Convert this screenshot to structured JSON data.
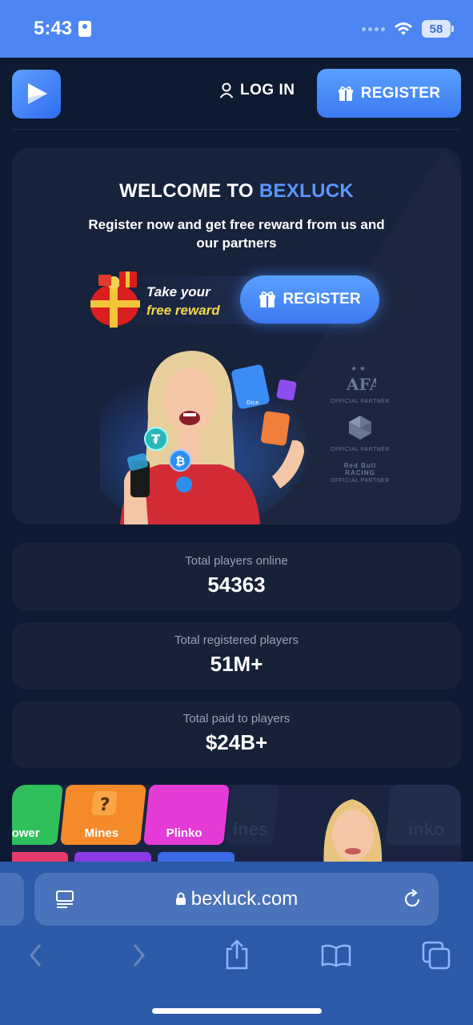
{
  "status_bar": {
    "time": "5:43",
    "battery": "58"
  },
  "header": {
    "login_label": "LOG IN",
    "register_label": "REGISTER"
  },
  "hero": {
    "title_prefix": "WELCOME TO ",
    "title_brand": "BEXLUCK",
    "subtitle": "Register now and get free reward from us and our partners",
    "reward_line1": "Take your",
    "reward_line2": "free reward",
    "register_label": "REGISTER",
    "card_labels": [
      "Dice"
    ],
    "partners": [
      {
        "logo_text": "AFA",
        "label": "OFFICIAL PARTNER"
      },
      {
        "logo_text": "",
        "label": "OFFICIAL PARTNER"
      },
      {
        "logo_text": "Red Bull RACING",
        "label": "OFFICIAL PARTNER"
      }
    ]
  },
  "stats": [
    {
      "label": "Total players online",
      "value": "54363"
    },
    {
      "label": "Total registered players",
      "value": "51M+"
    },
    {
      "label": "Total paid to players",
      "value": "$24B+"
    }
  ],
  "games": [
    "ower",
    "Mines",
    "Plinko",
    "ines",
    "inko"
  ],
  "browser": {
    "url": "bexluck.com"
  },
  "colors": {
    "accent": "#4d86f2",
    "brand_text": "#5b97ff",
    "reward_yellow": "#f6d64a"
  }
}
